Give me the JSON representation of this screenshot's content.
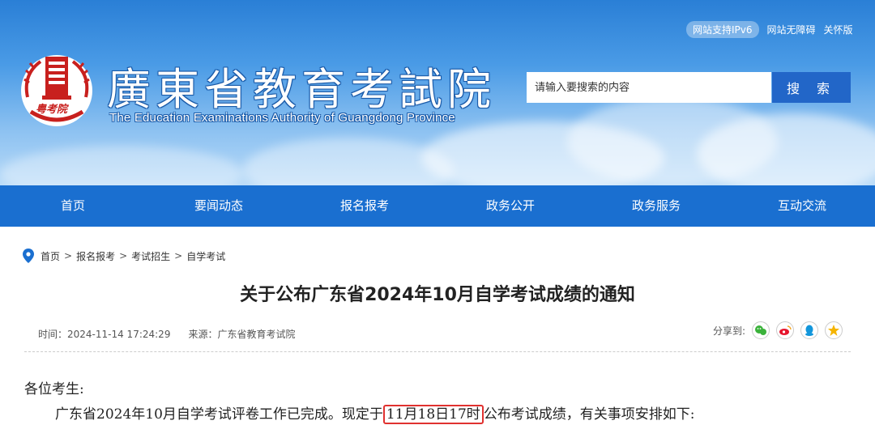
{
  "header": {
    "title": "廣東省教育考試院",
    "subtitle": "The Education Examinations Authority of Guangdong Province",
    "logo_text": "粤考院",
    "ipv6_badge": "网站支持IPv6",
    "accessibility_link": "网站无障碍",
    "elderly_link": "关怀版",
    "search": {
      "placeholder": "请输入要搜索的内容",
      "button_label": "搜 索"
    }
  },
  "nav": {
    "items": [
      {
        "label": "首页"
      },
      {
        "label": "要闻动态"
      },
      {
        "label": "报名报考"
      },
      {
        "label": "政务公开"
      },
      {
        "label": "政务服务"
      },
      {
        "label": "互动交流"
      }
    ]
  },
  "breadcrumb": {
    "items": [
      {
        "label": "首页"
      },
      {
        "label": "报名报考"
      },
      {
        "label": "考试招生"
      },
      {
        "label": "自学考试"
      }
    ],
    "separator": ">"
  },
  "article": {
    "title": "关于公布广东省2024年10月自学考试成绩的通知",
    "time": "时间：2024-11-14 17:24:29",
    "source": "来源：广东省教育考试院",
    "share_label": "分享到:",
    "share_icons": [
      "wechat-icon",
      "weibo-icon",
      "qq-icon",
      "qzone-icon"
    ],
    "greeting": "各位考生:",
    "body_before": "广东省2024年10月自学考试评卷工作已完成。现定于",
    "body_highlight": "11月18日17时",
    "body_after": "公布考试成绩，有关事项安排如下:"
  },
  "colors": {
    "nav_bg": "#1a6fd0",
    "search_button": "#2266c8",
    "highlight_border": "#e0312f",
    "logo_red": "#c8201e"
  }
}
